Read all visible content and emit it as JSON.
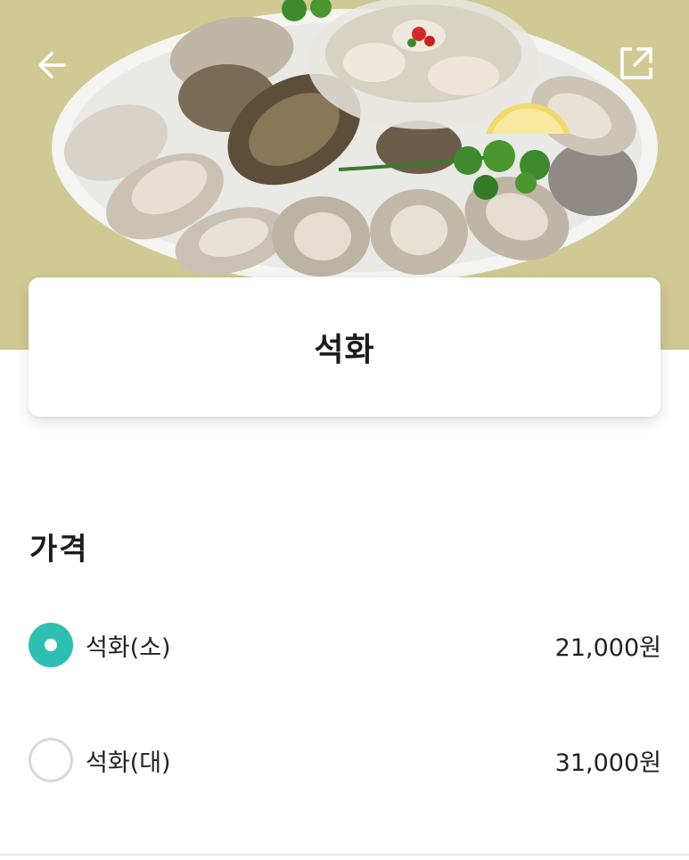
{
  "hero": {
    "image_alt": ""
  },
  "header": {
    "back_icon": "arrow-left-icon",
    "share_icon": "share-external-icon"
  },
  "product": {
    "title": "석화"
  },
  "price_section": {
    "title": "가격",
    "options": [
      {
        "label": "석화(소)",
        "price": "21,000원",
        "selected": true
      },
      {
        "label": "석화(대)",
        "price": "31,000원",
        "selected": false
      }
    ]
  },
  "colors": {
    "accent": "#2ebfb2",
    "radio_border": "#d9d9d9",
    "text": "#222222"
  }
}
